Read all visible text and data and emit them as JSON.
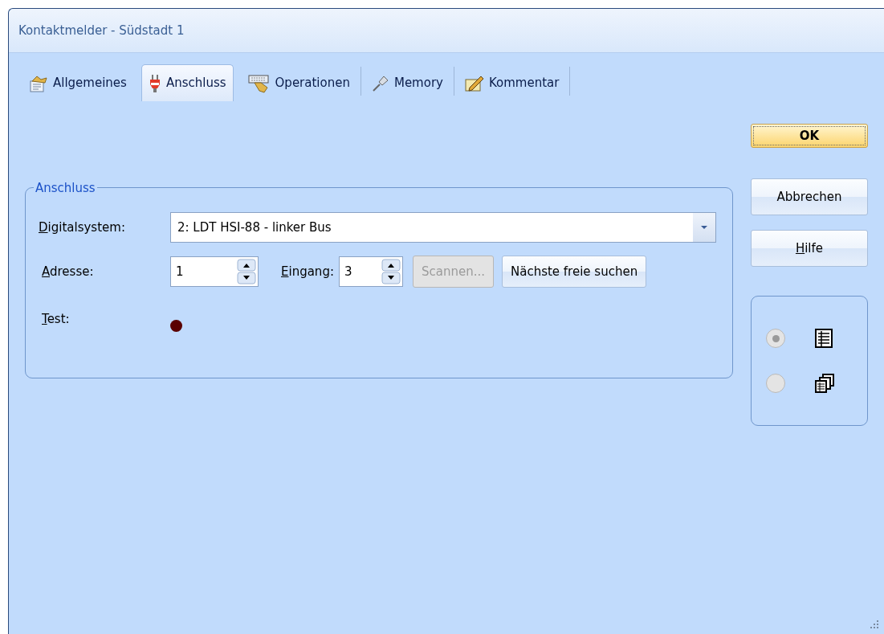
{
  "window": {
    "title": "Kontaktmelder - Südstadt 1"
  },
  "tabs": [
    {
      "label": "Allgemeines",
      "selected": false
    },
    {
      "label": "Anschluss",
      "selected": true
    },
    {
      "label": "Operationen",
      "selected": false
    },
    {
      "label": "Memory",
      "selected": false
    },
    {
      "label": "Kommentar",
      "selected": false
    }
  ],
  "group": {
    "title": "Anschluss",
    "digitalsystem": {
      "label": "Digitalsystem:",
      "underline_first": true,
      "value": "2: LDT HSI-88 - linker Bus"
    },
    "adresse": {
      "label": "Adresse:",
      "underline_first": true,
      "value": "1"
    },
    "eingang": {
      "label": "Eingang:",
      "underline_first": true,
      "value": "3"
    },
    "buttons": [
      {
        "label": "Scannen...",
        "disabled": true
      },
      {
        "label": "Nächste freie suchen",
        "disabled": false
      }
    ],
    "test": {
      "label": "Test:",
      "underline_first": true,
      "color": "#5a0000"
    }
  },
  "buttons": [
    {
      "label": "OK",
      "default": true,
      "underline_first": false
    },
    {
      "label": "Abbrechen",
      "default": false,
      "underline_first": false
    },
    {
      "label": "Hilfe",
      "default": false,
      "underline_first": true
    }
  ],
  "view_options": [
    {
      "selected": true,
      "disabled": true
    },
    {
      "selected": false,
      "disabled": true
    }
  ]
}
